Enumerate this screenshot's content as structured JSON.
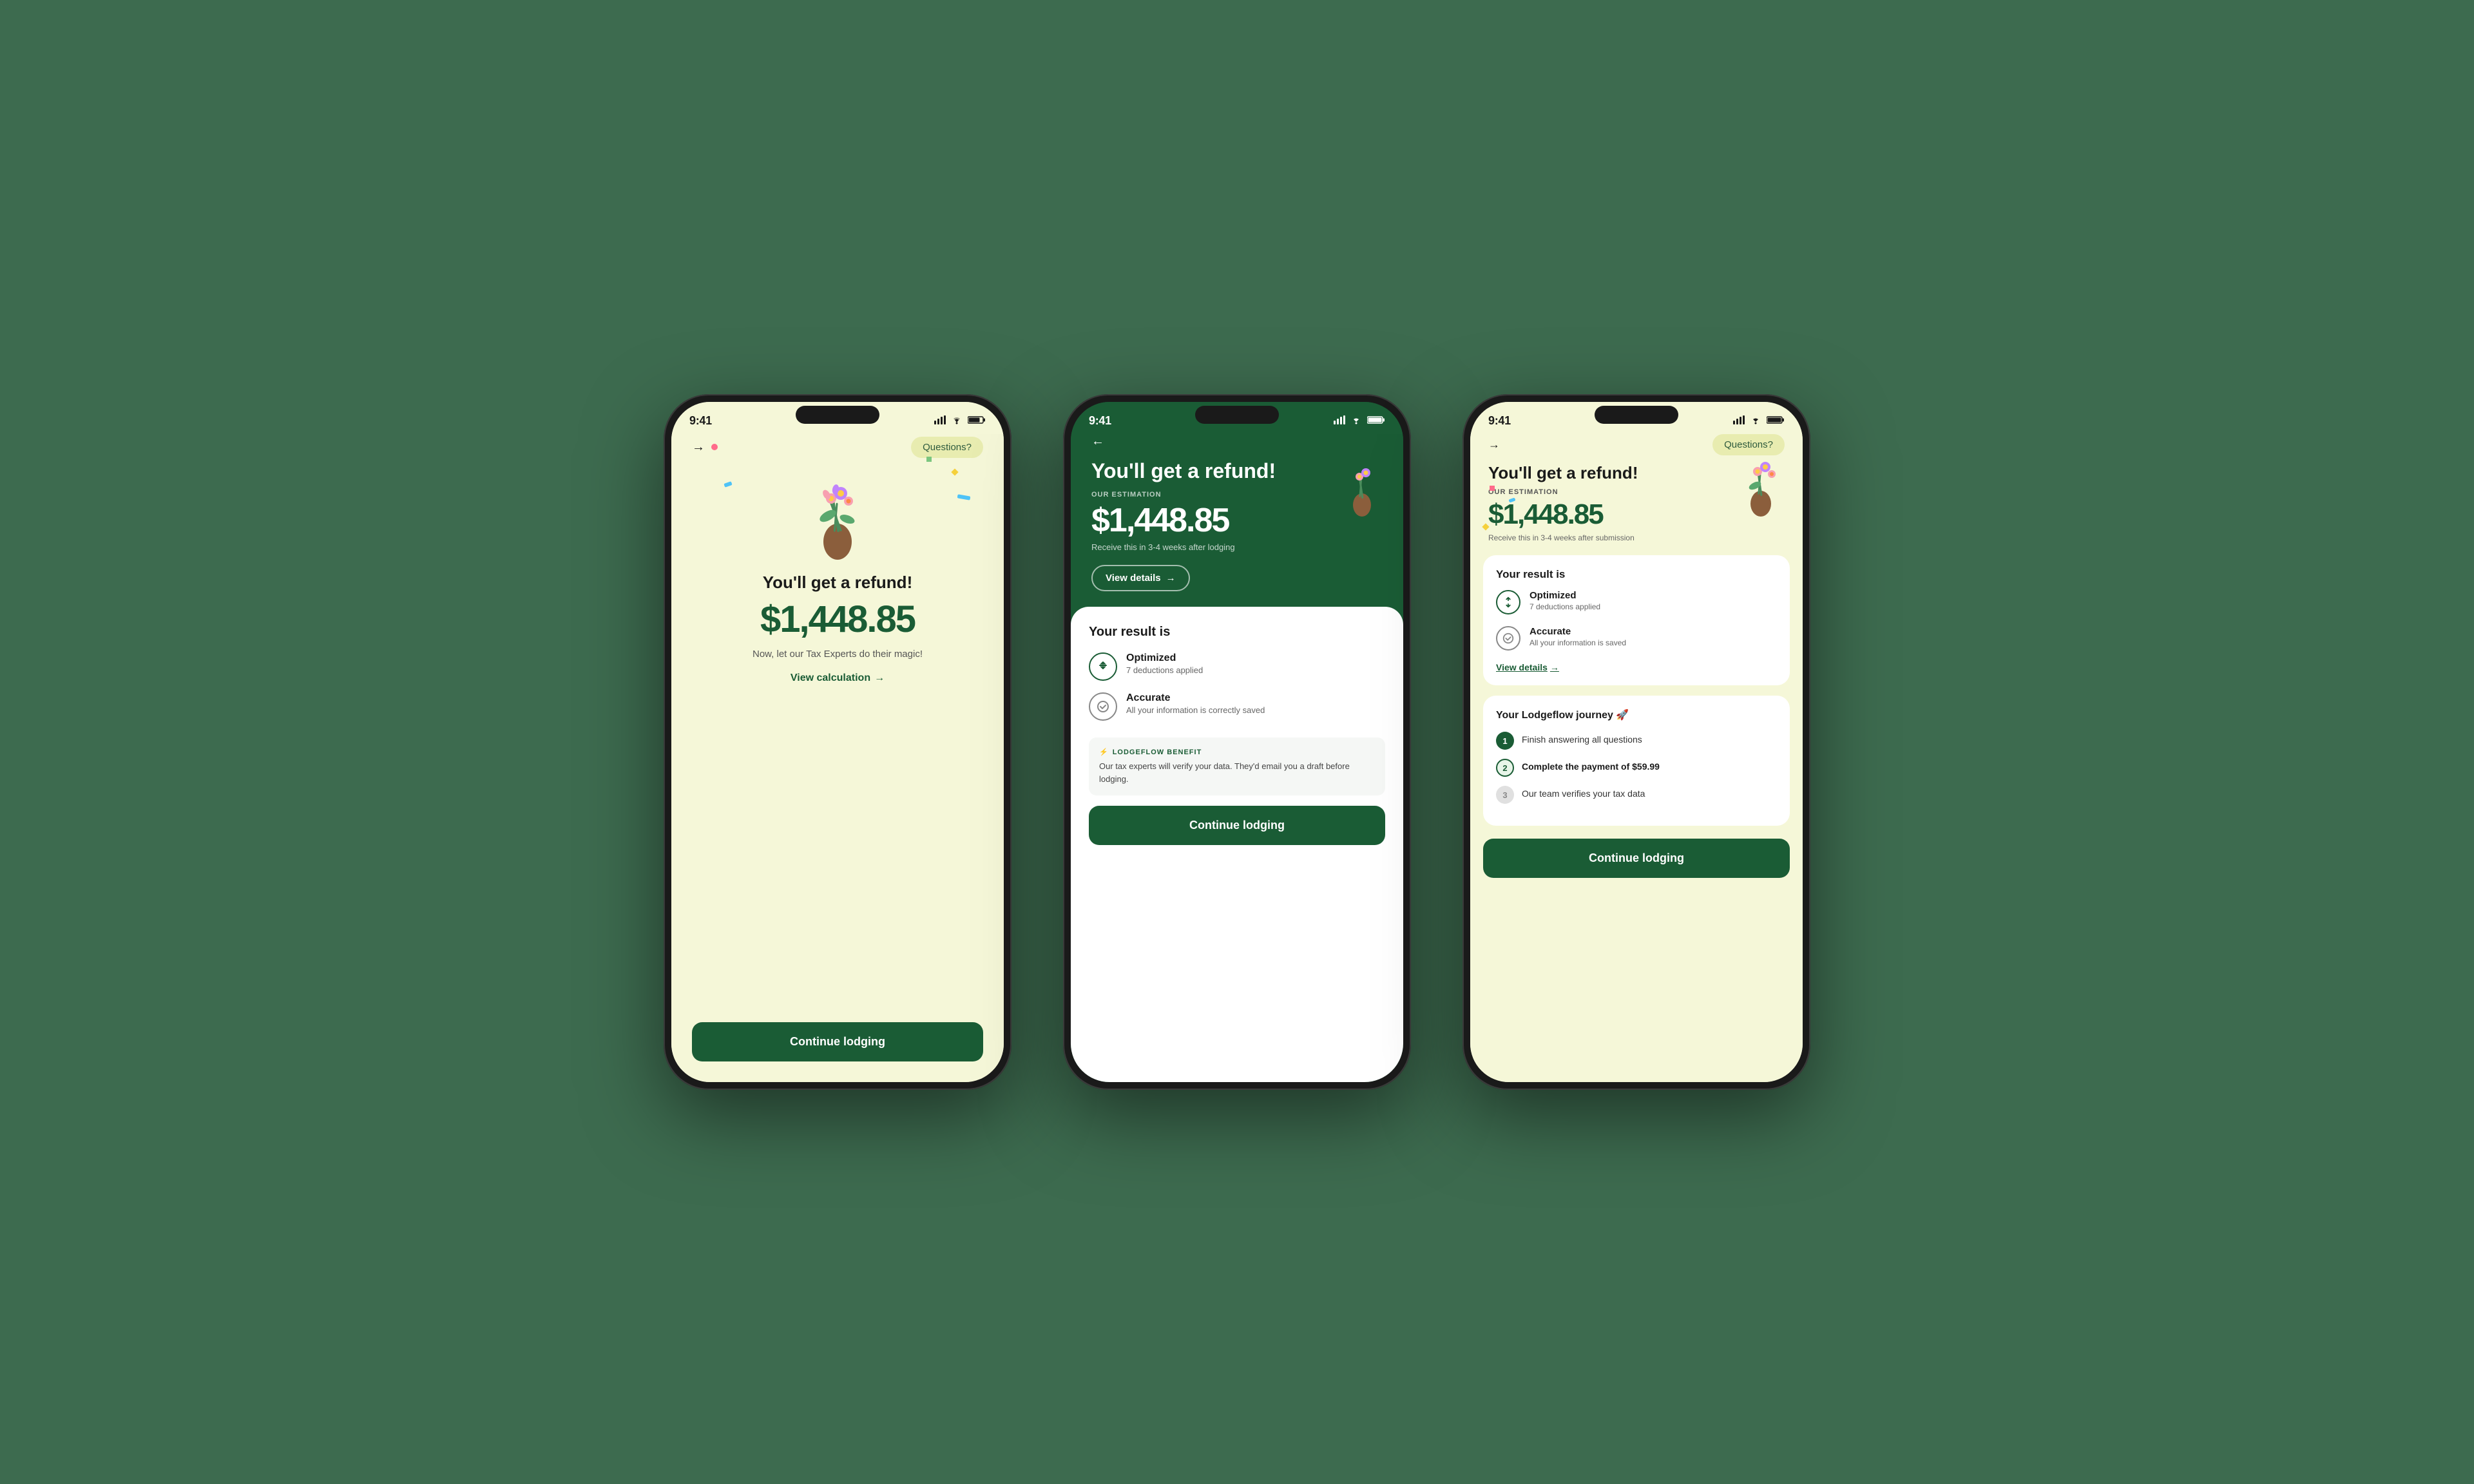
{
  "phones": {
    "phone1": {
      "statusTime": "9:41",
      "topNav": {
        "backArrow": "→",
        "questionsBtn": "Questions?"
      },
      "heading": "You'll get a refund!",
      "amount": "$1,448.85",
      "subtitle": "Now, let our Tax Experts do their magic!",
      "viewCalcLink": "View calculation",
      "continueBtn": "Continue lodging"
    },
    "phone2": {
      "statusTime": "9:41",
      "backArrow": "←",
      "heading": "You'll get a refund!",
      "estimationLabel": "OUR ESTIMATION",
      "amount": "$1,448.85",
      "receiveText": "Receive this in 3-4 weeks after lodging",
      "viewDetailsBtn": "View details",
      "yourResultTitle": "Your result is",
      "optimizedLabel": "Optimized",
      "optimizedSub": "7 deductions applied",
      "accurateLabel": "Accurate",
      "accurateSub": "All your information is correctly saved",
      "benefitLabel": "LODGEFLOW BENEFIT",
      "benefitText": "Our tax experts will verify your data. They'd email you a draft before lodging.",
      "continueBtn": "Continue lodging"
    },
    "phone3": {
      "statusTime": "9:41",
      "backArrow": "→",
      "questionsBtn": "Questions?",
      "heading": "You'll get a refund!",
      "estimationLabel": "OUR ESTIMATION",
      "amount": "$1,448.85",
      "receiveText": "Receive this in 3-4 weeks after submission",
      "yourResultTitle": "Your result is",
      "optimizedLabel": "Optimized",
      "optimizedSub": "7 deductions applied",
      "accurateLabel": "Accurate",
      "accurateSub": "All your information is saved",
      "viewDetailsLink": "View details",
      "journeyTitle": "Your Lodgeflow journey 🚀",
      "step1": "Finish answering all questions",
      "step2": "Complete the payment of $59.99",
      "step3": "Our team verifies your tax data",
      "continueBtn": "Continue lodging"
    }
  }
}
